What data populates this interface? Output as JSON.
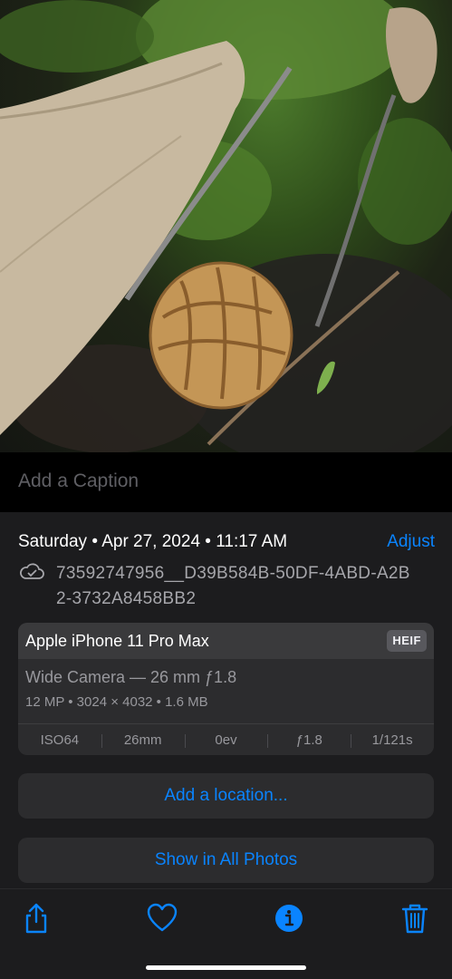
{
  "photo": {
    "subject": "morel-mushroom-photo"
  },
  "caption": {
    "placeholder": "Add a Caption"
  },
  "info": {
    "date": "Saturday • Apr 27, 2024 • 11:17 AM",
    "adjust_label": "Adjust",
    "filename": "73592747956__D39B584B-50DF-4ABD-A2B2-3732A8458BB2",
    "device": "Apple iPhone 11 Pro Max",
    "format": "HEIF",
    "lens": "Wide Camera — 26 mm ƒ1.8",
    "specs": "12 MP • 3024 × 4032 • 1.6 MB",
    "exif": [
      "ISO64",
      "26mm",
      "0ev",
      "ƒ1.8",
      "1/121s"
    ]
  },
  "buttons": {
    "location": "Add a location...",
    "show_all": "Show in All Photos"
  },
  "toolbar": {
    "icons": [
      "share-icon",
      "heart-icon",
      "info-icon",
      "trash-icon"
    ],
    "accent": "#0a84ff"
  },
  "colors": {
    "accent": "#0a84ff",
    "panel": "#1c1c1e",
    "card": "#2c2c2e"
  }
}
